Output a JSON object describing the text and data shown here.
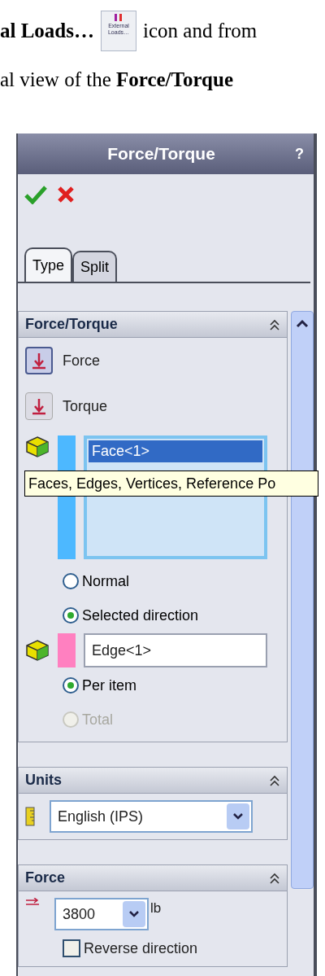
{
  "document": {
    "line_1_before": "**al Loads…**",
    "icon_label": "External Loads…",
    "line_1_after": "icon and from",
    "line_2": "al view of the **Force/Torque**"
  },
  "panel": {
    "title": "Force/Torque",
    "help": "?",
    "tabs": [
      {
        "label": "Type",
        "selected": true
      },
      {
        "label": "Split",
        "selected": false
      }
    ],
    "force_section": {
      "title": "Force/Torque",
      "types": [
        {
          "label": "Force",
          "selected": true
        },
        {
          "label": "Torque",
          "selected": false
        }
      ],
      "selection_list": {
        "color": "#4db8ff",
        "items": [
          {
            "label": "Face<1>",
            "selected": true
          }
        ]
      },
      "tooltip": "Faces, Edges, Vertices, Reference Po",
      "direction_options": [
        {
          "label": "Normal",
          "selected": false,
          "disabled": false
        },
        {
          "label": "Selected direction",
          "selected": true,
          "disabled": false
        }
      ],
      "direction_field": {
        "color": "#ff80c0",
        "value": "Edge<1>"
      },
      "apply_options": [
        {
          "label": "Per item",
          "selected": true,
          "disabled": false
        },
        {
          "label": "Total",
          "selected": false,
          "disabled": true
        }
      ]
    },
    "units_section": {
      "title": "Units",
      "value": "English (IPS)"
    },
    "force_value_section": {
      "title": "Force",
      "value": "3800",
      "unit": "lb",
      "reverse": {
        "label": "Reverse direction",
        "checked": false
      }
    }
  }
}
